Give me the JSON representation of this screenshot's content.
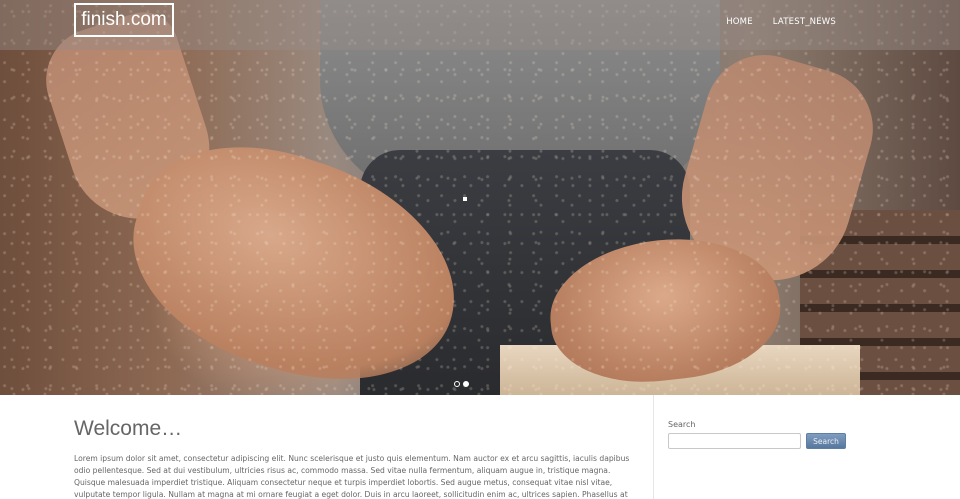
{
  "header": {
    "logo_text": "finish.com",
    "nav": [
      {
        "label": "HOME"
      },
      {
        "label": "LATEST_NEWS"
      }
    ]
  },
  "hero": {
    "slide_count": 2,
    "active_slide": 2
  },
  "main": {
    "title": "Welcome…",
    "body": "Lorem ipsum dolor sit amet, consectetur adipiscing elit. Nunc scelerisque et justo quis elementum. Nam auctor ex et arcu sagittis, iaculis dapibus odio pellentesque. Sed at dui vestibulum, ultricies risus ac, commodo massa. Sed vitae nulla fermentum, aliquam augue in, tristique magna. Quisque malesuada imperdiet tristique. Aliquam consectetur neque et turpis imperdiet lobortis. Sed augue metus, consequat vitae nisl vitae, vulputate tempor ligula. Nullam at magna at mi ornare feugiat a eget dolor. Duis in arcu laoreet, sollicitudin enim ac, ultrices sapien. Phasellus at leo"
  },
  "sidebar": {
    "search": {
      "label": "Search",
      "value": "",
      "button_label": "Search"
    }
  },
  "colors": {
    "search_button": "#6b89ae",
    "topbar_overlay": "#968c87"
  }
}
